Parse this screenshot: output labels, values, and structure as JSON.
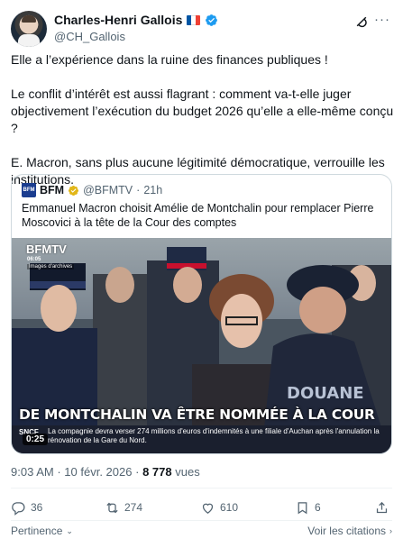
{
  "author": {
    "name": "Charles-Henri Gallois",
    "handle": "@CH_Gallois",
    "flag_colors": [
      "#0055a4",
      "#ffffff",
      "#ef4135"
    ],
    "verified_color": "#1d9bf0"
  },
  "tweet": {
    "paragraphs": [
      "Elle a l’expérience dans la ruine des finances publiques !",
      "Le conflit d’intérêt est aussi flagrant : comment va-t-elle juger objectivement l’exécution du budget 2026 qu’elle a elle-même conçu ?",
      "E. Macron, sans plus aucune légitimité démocratique, verrouille les institutions."
    ]
  },
  "quote": {
    "logo_text": "BFM",
    "name": "BFM",
    "verified_color": "#e2b719",
    "handle": "@BFMTV",
    "separator": "·",
    "age": "21h",
    "text": "Emmanuel Macron choisit Amélie de Montchalin pour remplacer Pierre Moscovici à la tête de la Cour des comptes",
    "video": {
      "watermark": "BFMTV",
      "timecode": "06:05",
      "archive_label": "Images d'archives",
      "headline": "DE MONTCHALIN VA ÊTRE NOMMÉE À LA COUR DES COMPTES",
      "jacket_text": "DOUANE",
      "ticker_label": "SNCF",
      "ticker_text": "La compagnie devra verser 274 millions d'euros d'indemnités à une filiale d'Auchan après l'annulation la rénovation de la Gare du Nord.",
      "duration": "0:25"
    }
  },
  "meta": {
    "time": "9:03 AM",
    "separator": "·",
    "date": "10 févr. 2026",
    "views_count": "8 778",
    "views_label": "vues"
  },
  "actions": {
    "replies": "36",
    "reposts": "274",
    "likes": "610",
    "bookmarks": "6"
  },
  "footer": {
    "relevance_label": "Pertinence",
    "citations_label": "Voir les citations"
  },
  "icons": [
    "grok-icon",
    "more-icon",
    "reply-icon",
    "repost-icon",
    "like-icon",
    "bookmark-icon",
    "share-icon",
    "chevron-down-icon",
    "chevron-right-icon"
  ]
}
